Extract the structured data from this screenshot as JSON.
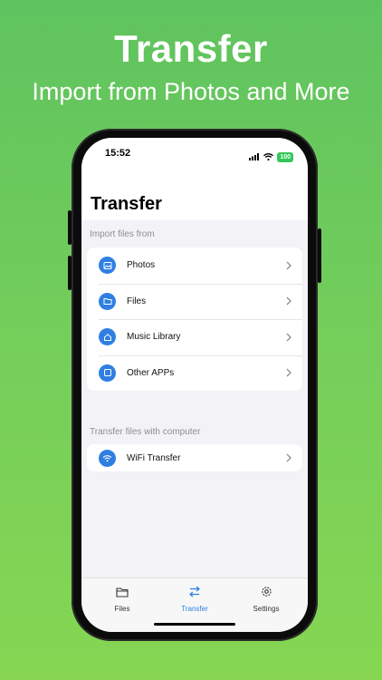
{
  "promo": {
    "title": "Transfer",
    "subtitle": "Import from Photos and More"
  },
  "status_bar": {
    "time": "15:52",
    "battery": "100",
    "icons": [
      "signal-icon",
      "wifi-icon",
      "battery-icon"
    ]
  },
  "header": {
    "title": "Transfer"
  },
  "import_section": {
    "header": "Import files from",
    "items": [
      {
        "label": "Photos",
        "icon": "photo-icon"
      },
      {
        "label": "Files",
        "icon": "folder-icon"
      },
      {
        "label": "Music Library",
        "icon": "house-icon"
      },
      {
        "label": "Other APPs",
        "icon": "square-icon"
      }
    ]
  },
  "computer_section": {
    "header": "Transfer files with computer",
    "items": [
      {
        "label": "WiFi Transfer",
        "icon": "wifi-icon"
      }
    ]
  },
  "tab_bar": {
    "tabs": [
      {
        "label": "Files",
        "icon": "folder-icon",
        "active": false
      },
      {
        "label": "Transfer",
        "icon": "transfer-arrows-icon",
        "active": true
      },
      {
        "label": "Settings",
        "icon": "gear-icon",
        "active": false
      }
    ]
  },
  "colors": {
    "background_green": "#6cc95c",
    "accent_blue": "#2f7fe3",
    "battery_green": "#34c759"
  }
}
